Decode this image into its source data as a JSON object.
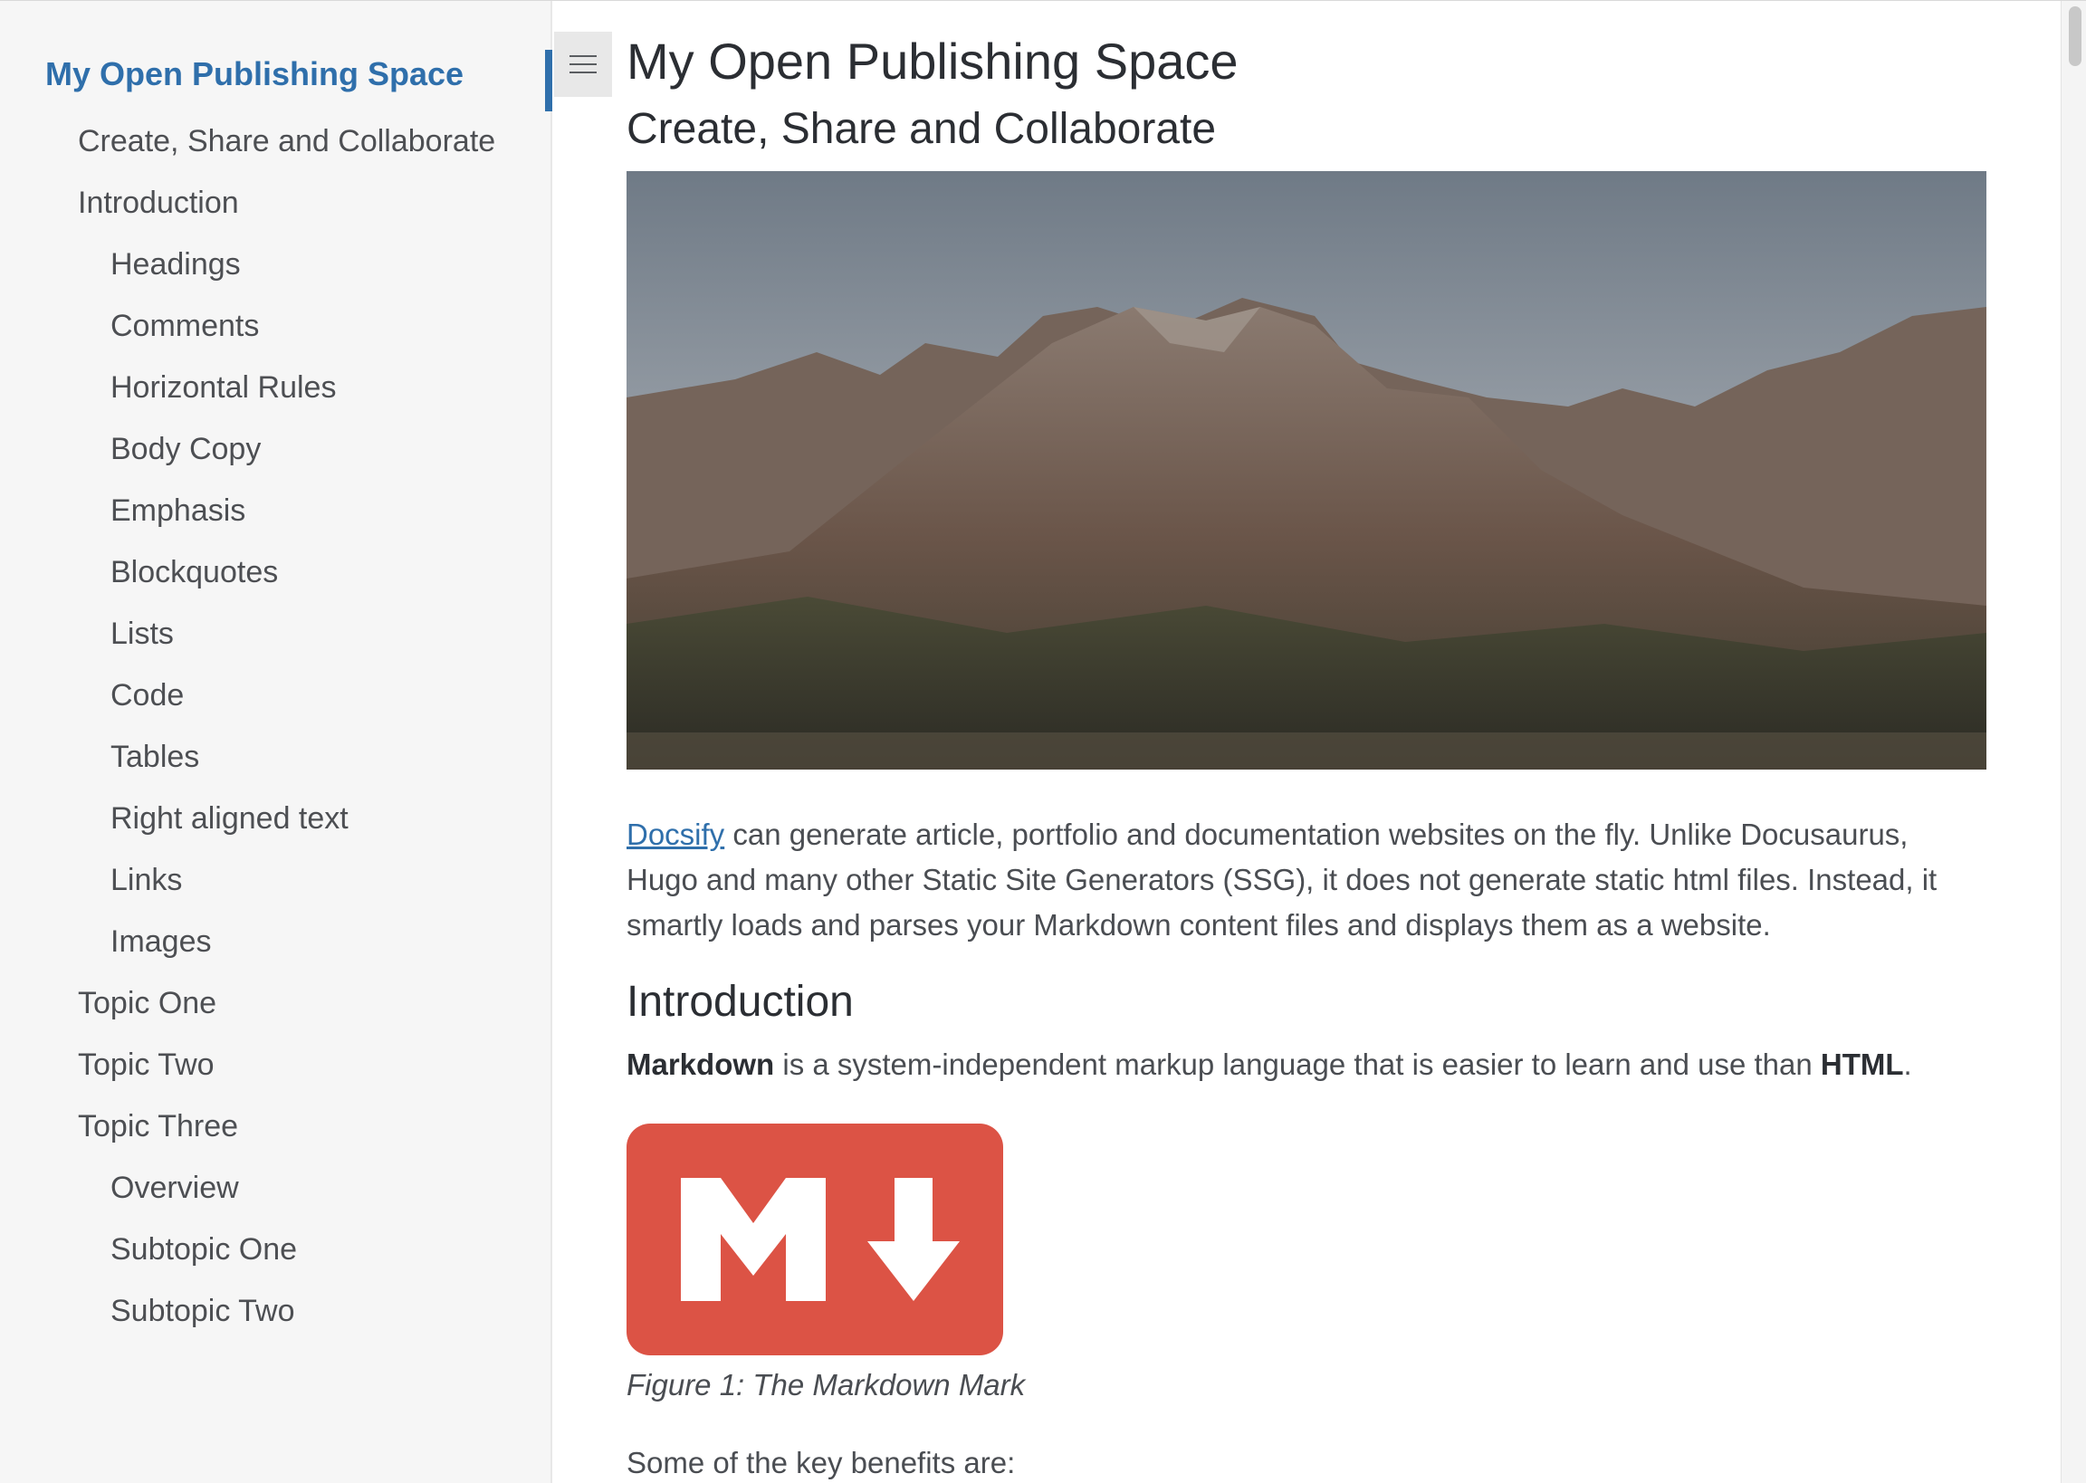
{
  "sidebar": {
    "title": "My Open Publishing Space",
    "items": [
      {
        "label": "Create, Share and Collaborate",
        "level": 1
      },
      {
        "label": "Introduction",
        "level": 1
      },
      {
        "label": "Headings",
        "level": 2
      },
      {
        "label": "Comments",
        "level": 2
      },
      {
        "label": "Horizontal Rules",
        "level": 2
      },
      {
        "label": "Body Copy",
        "level": 2
      },
      {
        "label": "Emphasis",
        "level": 2
      },
      {
        "label": "Blockquotes",
        "level": 2
      },
      {
        "label": "Lists",
        "level": 2
      },
      {
        "label": "Code",
        "level": 2
      },
      {
        "label": "Tables",
        "level": 2
      },
      {
        "label": "Right aligned text",
        "level": 2
      },
      {
        "label": "Links",
        "level": 2
      },
      {
        "label": "Images",
        "level": 2
      },
      {
        "label": "Topic One",
        "level": 1
      },
      {
        "label": "Topic Two",
        "level": 1
      },
      {
        "label": "Topic Three",
        "level": 1
      },
      {
        "label": "Overview",
        "level": 2
      },
      {
        "label": "Subtopic One",
        "level": 2
      },
      {
        "label": "Subtopic Two",
        "level": 2
      }
    ]
  },
  "toggle": {
    "icon": "hamburger-menu-icon"
  },
  "content": {
    "title": "My Open Publishing Space",
    "subtitle": "Create, Share and Collaborate",
    "hero_image": "mountain-landscape",
    "intro_link": "Docsify",
    "intro_text": " can generate article, portfolio and documentation websites on the fly. Unlike Docusaurus, Hugo and many other Static Site Generators (SSG), it does not generate static html files. Instead, it smartly loads and parses your Markdown content files and displays them as a website.",
    "section_heading": "Introduction",
    "markdown_bold": "Markdown",
    "markdown_text": " is a system-independent markup language that is easier to learn and use than ",
    "html_bold": "HTML",
    "period": ".",
    "figure_caption": "Figure 1: The Markdown Mark",
    "benefits_text": "Some of the key benefits are:"
  },
  "colors": {
    "accent": "#2f6fab",
    "markdown_logo": "#dc5345"
  }
}
